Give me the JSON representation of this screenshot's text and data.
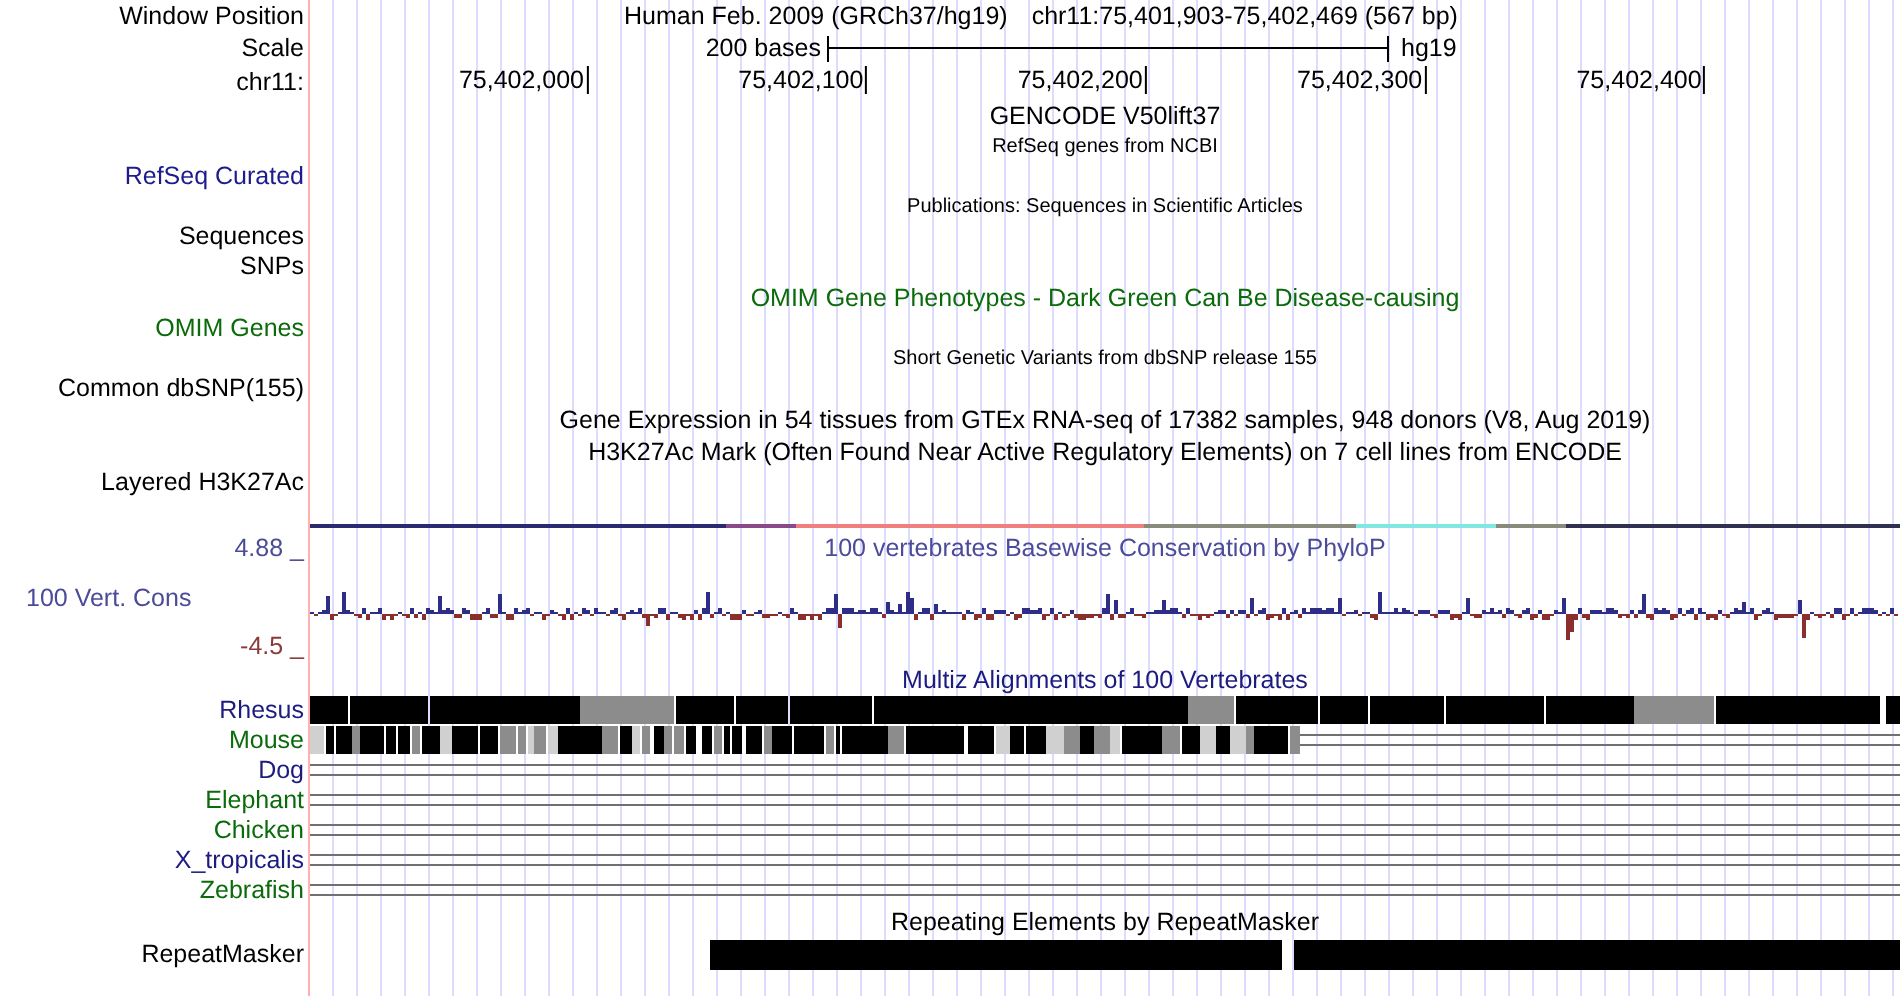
{
  "header": {
    "label": "Window Position",
    "assembly": "Human Feb. 2009 (GRCh37/hg19)",
    "position": "chr11:75,401,903-75,402,469 (567 bp)"
  },
  "scale": {
    "label": "Scale",
    "span": "200 bases",
    "genome": "hg19"
  },
  "ruler": {
    "label": "chr11:",
    "ticks": [
      "75,402,000",
      "75,402,100",
      "75,402,200",
      "75,402,300",
      "75,402,400"
    ]
  },
  "tracks": [
    {
      "kind": "caption",
      "text": "GENCODE V50lift37",
      "color": "#000000"
    },
    {
      "kind": "note",
      "text": "RefSeq genes from NCBI",
      "color": "#000000"
    },
    {
      "kind": "label",
      "label": "RefSeq Curated",
      "color": "#1c1c8c"
    },
    {
      "kind": "note",
      "text": "Publications: Sequences in Scientific Articles",
      "color": "#000000"
    },
    {
      "kind": "label",
      "label": "Sequences",
      "color": "#000000"
    },
    {
      "kind": "label",
      "label": "SNPs",
      "color": "#000000"
    },
    {
      "kind": "caption",
      "text": "OMIM Gene Phenotypes - Dark Green Can Be Disease-causing",
      "color": "#0b6b0b"
    },
    {
      "kind": "label",
      "label": "OMIM Genes",
      "color": "#0b6b0b"
    },
    {
      "kind": "note",
      "text": "Short Genetic Variants from dbSNP release 155",
      "color": "#000000"
    },
    {
      "kind": "label",
      "label": "Common dbSNP(155)",
      "color": "#000000"
    },
    {
      "kind": "caption",
      "text": "Gene Expression in 54 tissues from GTEx RNA-seq of 17382 samples, 948 donors (V8, Aug 2019)",
      "color": "#000000"
    },
    {
      "kind": "caption",
      "text": "H3K27Ac Mark (Often Found Near Active Regulatory Elements) on 7 cell lines from ENCODE",
      "color": "#000000"
    },
    {
      "kind": "label",
      "label": "Layered H3K27Ac",
      "color": "#000000"
    },
    {
      "kind": "layered"
    },
    {
      "kind": "wiggle",
      "label": "100 Vert. Cons",
      "color": "#4b4b9a",
      "title": "100 vertebrates Basewise Conservation by PhyloP",
      "max": "4.88 _",
      "min": "-4.5 _"
    },
    {
      "kind": "caption",
      "text": "Multiz Alignments of 100 Vertebrates",
      "color": "#1c1c80"
    },
    {
      "kind": "blocks",
      "label": "Rhesus",
      "color": "#1c1c80"
    },
    {
      "kind": "fragments",
      "label": "Mouse",
      "color": "#0b6b0b"
    },
    {
      "kind": "gaps",
      "label": "Dog",
      "color": "#1c1c80"
    },
    {
      "kind": "gaps",
      "label": "Elephant",
      "color": "#0b6b0b"
    },
    {
      "kind": "gaps",
      "label": "Chicken",
      "color": "#0b6b0b"
    },
    {
      "kind": "gaps",
      "label": "X_tropicalis",
      "color": "#1c1c80"
    },
    {
      "kind": "gaps",
      "label": "Zebrafish",
      "color": "#0b6b0b"
    },
    {
      "kind": "caption",
      "text": "Repeating Elements by RepeatMasker",
      "color": "#000000"
    },
    {
      "kind": "repeats",
      "label": "RepeatMasker",
      "color": "#000000"
    }
  ]
}
